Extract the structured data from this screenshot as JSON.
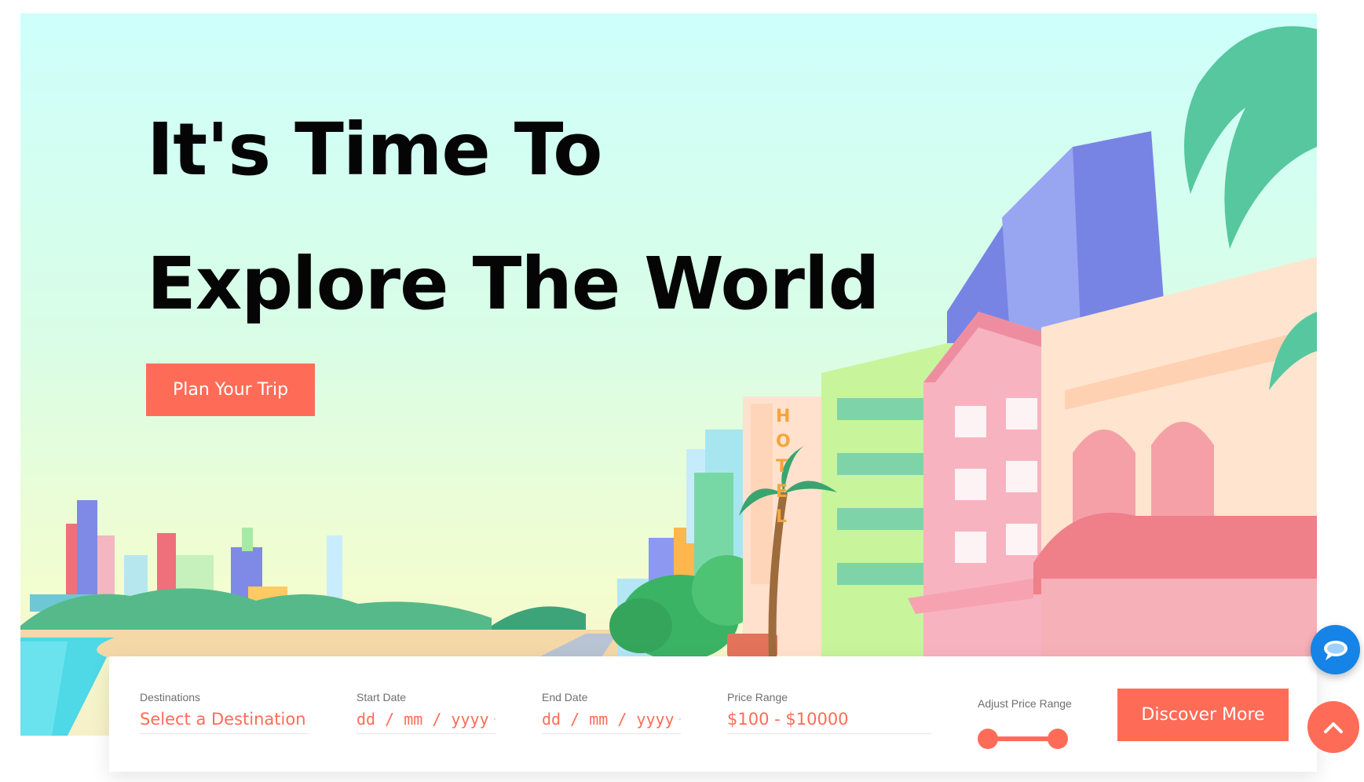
{
  "hero": {
    "headline_line1": "It's Time To",
    "headline_line2": "Explore The World",
    "plan_button_label": "Plan Your Trip",
    "hotel_sign": "HOTEL",
    "illustration_icon": "city-beach-illustration"
  },
  "search": {
    "destination": {
      "label": "Destinations",
      "value": "Select a Destination"
    },
    "start_date": {
      "label": "Start Date",
      "placeholder": "dd / mm / yyyy"
    },
    "end_date": {
      "label": "End Date",
      "placeholder": "dd / mm / yyyy"
    },
    "price_range": {
      "label": "Price Range",
      "value": "$100 - $10000"
    },
    "adjust_price": {
      "label": "Adjust Price Range",
      "min_fraction": 0,
      "max_fraction": 1
    },
    "discover_button_label": "Discover More"
  },
  "floating": {
    "chat_icon": "chat-bubble-icon",
    "scroll_top_icon": "chevron-up-icon"
  },
  "colors": {
    "accent": "#fe6c58",
    "chat": "#1683e6",
    "headline": "#050505"
  }
}
